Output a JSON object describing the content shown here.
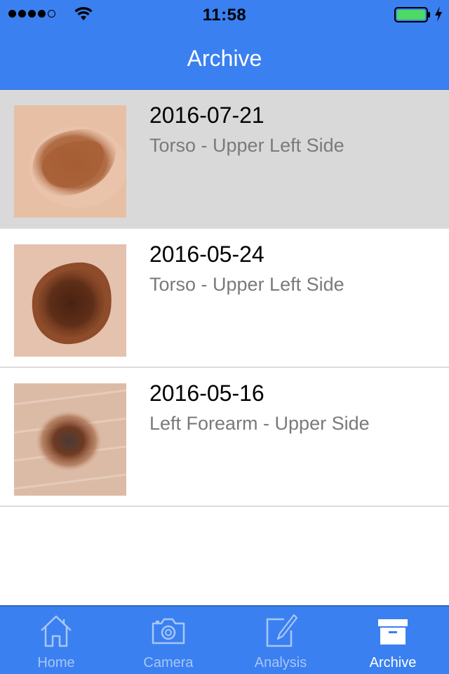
{
  "status_bar": {
    "time": "11:58",
    "signal_bars": 4,
    "signal_max": 5,
    "battery_level": 1.0,
    "battery_color": "#4cd964",
    "charging": true
  },
  "nav": {
    "title": "Archive",
    "background": "#3a80f0"
  },
  "entries": [
    {
      "date": "2016-07-21",
      "location": "Torso - Upper Left Side",
      "selected": true
    },
    {
      "date": "2016-05-24",
      "location": "Torso - Upper Left Side",
      "selected": false
    },
    {
      "date": "2016-05-16",
      "location": "Left Forearm - Upper Side",
      "selected": false
    }
  ],
  "tabs": [
    {
      "label": "Home",
      "icon": "home-icon",
      "active": false
    },
    {
      "label": "Camera",
      "icon": "camera-icon",
      "active": false
    },
    {
      "label": "Analysis",
      "icon": "analysis-edit-icon",
      "active": false
    },
    {
      "label": "Archive",
      "icon": "archive-box-icon",
      "active": true
    }
  ]
}
